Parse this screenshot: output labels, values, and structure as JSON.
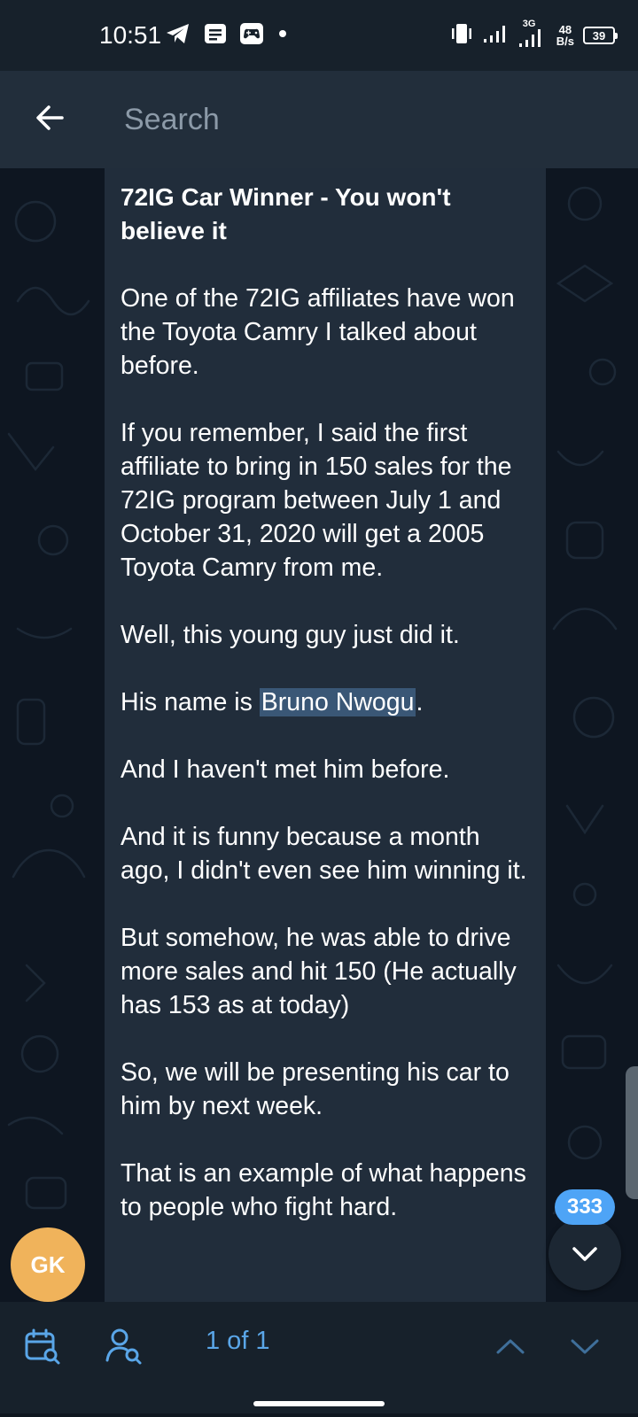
{
  "status_bar": {
    "time": "10:51",
    "network": "3G",
    "speed_value": "48",
    "speed_unit": "B/s",
    "battery": "39"
  },
  "header": {
    "search_placeholder": "Search"
  },
  "message": {
    "title": "72IG Car Winner - You won't believe it",
    "paragraphs": [
      "One of the 72IG affiliates have won the Toyota Camry I talked about before.",
      "If you remember, I said the first affiliate to bring in 150 sales for the 72IG program between July 1 and October 31, 2020 will get a 2005 Toyota Camry from me.",
      "Well, this young guy just did it.",
      "And I haven't met him before.",
      "And it is funny because a month ago, I didn't even see him winning it.",
      "But somehow, he was able to drive more sales and hit 150 (He actually has 153 as at today)",
      "So, we will be presenting his car to him by next week.",
      "That is an example of what happens to people who fight hard."
    ],
    "name_prefix": "His name is ",
    "name_highlight": "Bruno Nwogu",
    "name_suffix": "."
  },
  "avatar": {
    "initials": "GK",
    "color": "#f0b35b"
  },
  "scroll": {
    "unread_count": "333"
  },
  "bottom_bar": {
    "result_counter": "1 of 1"
  },
  "colors": {
    "accent": "#5aa6e8",
    "badge": "#4ea4f6",
    "bubble": "#212d3b",
    "highlight": "#3a5776"
  }
}
